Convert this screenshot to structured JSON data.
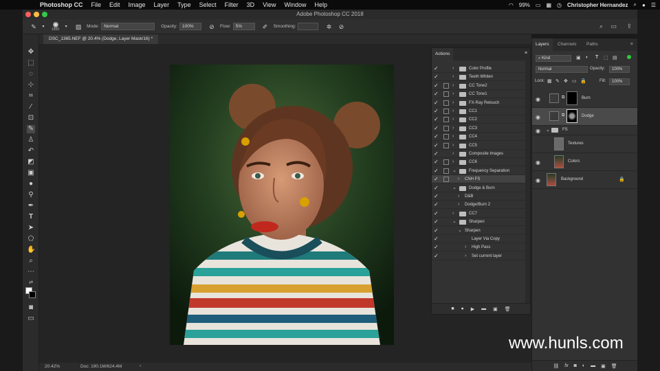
{
  "menubar": {
    "app_name": "Photoshop CC",
    "items": [
      "File",
      "Edit",
      "Image",
      "Layer",
      "Type",
      "Select",
      "Filter",
      "3D",
      "View",
      "Window",
      "Help"
    ],
    "battery": "99%",
    "user": "Christopher Hernandez"
  },
  "window": {
    "title": "Adobe Photoshop CC 2018"
  },
  "options": {
    "brush_size": "1500",
    "mode_label": "Mode:",
    "mode_value": "Normal",
    "opacity_label": "Opacity:",
    "opacity_value": "100%",
    "flow_label": "Flow:",
    "flow_value": "5%",
    "smoothing_label": "Smoothing:",
    "smoothing_value": ""
  },
  "document": {
    "tab_title": "DSC_1365.NEF @ 20.4% (Dodge, Layer Mask/16) *"
  },
  "status": {
    "zoom": "20.42%",
    "doc": "Doc: 190.1M/624.4M"
  },
  "actions": {
    "title": "Actions",
    "items": [
      {
        "label": "Color Profile",
        "level": 1,
        "folder": true,
        "expanded": false,
        "dialog": false
      },
      {
        "label": "Teeth Whiten",
        "level": 1,
        "folder": true,
        "expanded": false,
        "dialog": false
      },
      {
        "label": "CC Tone2",
        "level": 1,
        "folder": true,
        "expanded": false,
        "dialog": true
      },
      {
        "label": "CC Tone1",
        "level": 1,
        "folder": true,
        "expanded": false,
        "dialog": true
      },
      {
        "label": "FX-Ray Retouch",
        "level": 1,
        "folder": true,
        "expanded": false,
        "dialog": true
      },
      {
        "label": "CC1",
        "level": 1,
        "folder": true,
        "expanded": false,
        "dialog": true
      },
      {
        "label": "CC2",
        "level": 1,
        "folder": true,
        "expanded": false,
        "dialog": true
      },
      {
        "label": "CC3",
        "level": 1,
        "folder": true,
        "expanded": false,
        "dialog": true
      },
      {
        "label": "CC4",
        "level": 1,
        "folder": true,
        "expanded": false,
        "dialog": true
      },
      {
        "label": "CC5",
        "level": 1,
        "folder": true,
        "expanded": false,
        "dialog": true
      },
      {
        "label": "Composite Images",
        "level": 1,
        "folder": true,
        "expanded": false,
        "dialog": false
      },
      {
        "label": "CC6",
        "level": 1,
        "folder": true,
        "expanded": false,
        "dialog": true
      },
      {
        "label": "Frequency Separation",
        "level": 1,
        "folder": true,
        "expanded": true,
        "dialog": true
      },
      {
        "label": "CNH FS",
        "level": 2,
        "folder": false,
        "expanded": false,
        "dialog": true,
        "selected": true
      },
      {
        "label": "Dodge & Burn",
        "level": 1,
        "folder": true,
        "expanded": true,
        "dialog": false
      },
      {
        "label": "D&B",
        "level": 2,
        "folder": false,
        "expanded": false,
        "dialog": false
      },
      {
        "label": "Dodge/Burn 2",
        "level": 2,
        "folder": false,
        "expanded": false,
        "dialog": false
      },
      {
        "label": "CC7",
        "level": 1,
        "folder": true,
        "expanded": false,
        "dialog": false
      },
      {
        "label": "Sharpen",
        "level": 1,
        "folder": true,
        "expanded": true,
        "dialog": false
      },
      {
        "label": "Sharpen",
        "level": 2,
        "folder": false,
        "expanded": true,
        "dialog": false
      },
      {
        "label": "Layer Via Copy",
        "level": 3,
        "folder": false,
        "expanded": false,
        "dialog": false,
        "noarrow": true
      },
      {
        "label": "High Pass",
        "level": 3,
        "folder": false,
        "expanded": false,
        "dialog": false
      },
      {
        "label": "Set current layer",
        "level": 3,
        "folder": false,
        "expanded": false,
        "dialog": false
      }
    ]
  },
  "layers_panel": {
    "tabs": [
      "Layers",
      "Channels",
      "Paths"
    ],
    "filter_value": "Kind",
    "blend_mode": "Normal",
    "opacity_label": "Opacity:",
    "opacity_value": "100%",
    "lock_label": "Lock:",
    "fill_label": "Fill:",
    "fill_value": "100%",
    "layers": [
      {
        "name": "Burn",
        "type": "adjustment-mask",
        "selected": false
      },
      {
        "name": "Dodge",
        "type": "adjustment-mask",
        "selected": true
      },
      {
        "name": "FS",
        "type": "group"
      },
      {
        "name": "Textures",
        "type": "pixel"
      },
      {
        "name": "Colors",
        "type": "pixel"
      },
      {
        "name": "Background",
        "type": "background"
      }
    ]
  },
  "watermark": "www.hunls.com"
}
